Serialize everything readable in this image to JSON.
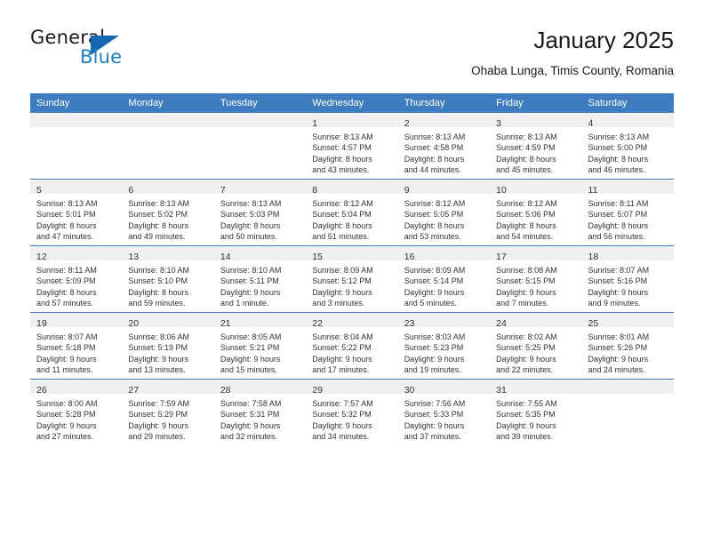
{
  "brand": {
    "general": "General",
    "blue": "Blue",
    "triangle_color": "#1668b0",
    "blue_color": "#1f7fc4"
  },
  "header": {
    "title": "January 2025",
    "subtitle": "Ohaba Lunga, Timis County, Romania"
  },
  "theme": {
    "header_blue": "#3c7cbf",
    "band_grey": "#f0f0f0",
    "text": "#333333"
  },
  "weekday_headers": [
    "Sunday",
    "Monday",
    "Tuesday",
    "Wednesday",
    "Thursday",
    "Friday",
    "Saturday"
  ],
  "weeks": [
    [
      {
        "day": "",
        "lines": []
      },
      {
        "day": "",
        "lines": []
      },
      {
        "day": "",
        "lines": []
      },
      {
        "day": "1",
        "lines": [
          "Sunrise: 8:13 AM",
          "Sunset: 4:57 PM",
          "Daylight: 8 hours",
          "and 43 minutes."
        ]
      },
      {
        "day": "2",
        "lines": [
          "Sunrise: 8:13 AM",
          "Sunset: 4:58 PM",
          "Daylight: 8 hours",
          "and 44 minutes."
        ]
      },
      {
        "day": "3",
        "lines": [
          "Sunrise: 8:13 AM",
          "Sunset: 4:59 PM",
          "Daylight: 8 hours",
          "and 45 minutes."
        ]
      },
      {
        "day": "4",
        "lines": [
          "Sunrise: 8:13 AM",
          "Sunset: 5:00 PM",
          "Daylight: 8 hours",
          "and 46 minutes."
        ]
      }
    ],
    [
      {
        "day": "5",
        "lines": [
          "Sunrise: 8:13 AM",
          "Sunset: 5:01 PM",
          "Daylight: 8 hours",
          "and 47 minutes."
        ]
      },
      {
        "day": "6",
        "lines": [
          "Sunrise: 8:13 AM",
          "Sunset: 5:02 PM",
          "Daylight: 8 hours",
          "and 49 minutes."
        ]
      },
      {
        "day": "7",
        "lines": [
          "Sunrise: 8:13 AM",
          "Sunset: 5:03 PM",
          "Daylight: 8 hours",
          "and 50 minutes."
        ]
      },
      {
        "day": "8",
        "lines": [
          "Sunrise: 8:12 AM",
          "Sunset: 5:04 PM",
          "Daylight: 8 hours",
          "and 51 minutes."
        ]
      },
      {
        "day": "9",
        "lines": [
          "Sunrise: 8:12 AM",
          "Sunset: 5:05 PM",
          "Daylight: 8 hours",
          "and 53 minutes."
        ]
      },
      {
        "day": "10",
        "lines": [
          "Sunrise: 8:12 AM",
          "Sunset: 5:06 PM",
          "Daylight: 8 hours",
          "and 54 minutes."
        ]
      },
      {
        "day": "11",
        "lines": [
          "Sunrise: 8:11 AM",
          "Sunset: 5:07 PM",
          "Daylight: 8 hours",
          "and 56 minutes."
        ]
      }
    ],
    [
      {
        "day": "12",
        "lines": [
          "Sunrise: 8:11 AM",
          "Sunset: 5:09 PM",
          "Daylight: 8 hours",
          "and 57 minutes."
        ]
      },
      {
        "day": "13",
        "lines": [
          "Sunrise: 8:10 AM",
          "Sunset: 5:10 PM",
          "Daylight: 8 hours",
          "and 59 minutes."
        ]
      },
      {
        "day": "14",
        "lines": [
          "Sunrise: 8:10 AM",
          "Sunset: 5:11 PM",
          "Daylight: 9 hours",
          "and 1 minute."
        ]
      },
      {
        "day": "15",
        "lines": [
          "Sunrise: 8:09 AM",
          "Sunset: 5:12 PM",
          "Daylight: 9 hours",
          "and 3 minutes."
        ]
      },
      {
        "day": "16",
        "lines": [
          "Sunrise: 8:09 AM",
          "Sunset: 5:14 PM",
          "Daylight: 9 hours",
          "and 5 minutes."
        ]
      },
      {
        "day": "17",
        "lines": [
          "Sunrise: 8:08 AM",
          "Sunset: 5:15 PM",
          "Daylight: 9 hours",
          "and 7 minutes."
        ]
      },
      {
        "day": "18",
        "lines": [
          "Sunrise: 8:07 AM",
          "Sunset: 5:16 PM",
          "Daylight: 9 hours",
          "and 9 minutes."
        ]
      }
    ],
    [
      {
        "day": "19",
        "lines": [
          "Sunrise: 8:07 AM",
          "Sunset: 5:18 PM",
          "Daylight: 9 hours",
          "and 11 minutes."
        ]
      },
      {
        "day": "20",
        "lines": [
          "Sunrise: 8:06 AM",
          "Sunset: 5:19 PM",
          "Daylight: 9 hours",
          "and 13 minutes."
        ]
      },
      {
        "day": "21",
        "lines": [
          "Sunrise: 8:05 AM",
          "Sunset: 5:21 PM",
          "Daylight: 9 hours",
          "and 15 minutes."
        ]
      },
      {
        "day": "22",
        "lines": [
          "Sunrise: 8:04 AM",
          "Sunset: 5:22 PM",
          "Daylight: 9 hours",
          "and 17 minutes."
        ]
      },
      {
        "day": "23",
        "lines": [
          "Sunrise: 8:03 AM",
          "Sunset: 5:23 PM",
          "Daylight: 9 hours",
          "and 19 minutes."
        ]
      },
      {
        "day": "24",
        "lines": [
          "Sunrise: 8:02 AM",
          "Sunset: 5:25 PM",
          "Daylight: 9 hours",
          "and 22 minutes."
        ]
      },
      {
        "day": "25",
        "lines": [
          "Sunrise: 8:01 AM",
          "Sunset: 5:26 PM",
          "Daylight: 9 hours",
          "and 24 minutes."
        ]
      }
    ],
    [
      {
        "day": "26",
        "lines": [
          "Sunrise: 8:00 AM",
          "Sunset: 5:28 PM",
          "Daylight: 9 hours",
          "and 27 minutes."
        ]
      },
      {
        "day": "27",
        "lines": [
          "Sunrise: 7:59 AM",
          "Sunset: 5:29 PM",
          "Daylight: 9 hours",
          "and 29 minutes."
        ]
      },
      {
        "day": "28",
        "lines": [
          "Sunrise: 7:58 AM",
          "Sunset: 5:31 PM",
          "Daylight: 9 hours",
          "and 32 minutes."
        ]
      },
      {
        "day": "29",
        "lines": [
          "Sunrise: 7:57 AM",
          "Sunset: 5:32 PM",
          "Daylight: 9 hours",
          "and 34 minutes."
        ]
      },
      {
        "day": "30",
        "lines": [
          "Sunrise: 7:56 AM",
          "Sunset: 5:33 PM",
          "Daylight: 9 hours",
          "and 37 minutes."
        ]
      },
      {
        "day": "31",
        "lines": [
          "Sunrise: 7:55 AM",
          "Sunset: 5:35 PM",
          "Daylight: 9 hours",
          "and 39 minutes."
        ]
      },
      {
        "day": "",
        "lines": []
      }
    ]
  ]
}
